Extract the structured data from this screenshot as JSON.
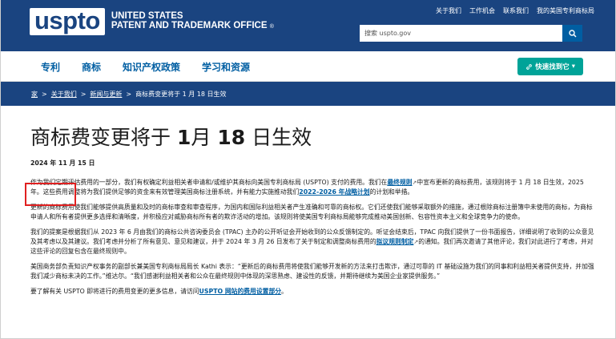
{
  "header": {
    "logo_word": "uspto",
    "logo_line1": "UNITED STATES",
    "logo_line2": "PATENT AND TRADEMARK OFFICE",
    "logo_reg": "®",
    "util_links": [
      "关于我们",
      "工作机会",
      "联系我们",
      "我的美国专利商标局"
    ],
    "search_placeholder": "搜索 uspto.gov"
  },
  "nav": {
    "items": [
      "专利",
      "商标",
      "知识产权政策",
      "学习和资源"
    ],
    "quick_button": "快速找到它"
  },
  "breadcrumb": {
    "home": "家",
    "about": "关于我们",
    "news": "新闻与更新",
    "current": "商标费变更将于 1 月 18 日生效"
  },
  "article": {
    "title_a": "商标费变更将于",
    "title_b": "1",
    "title_c": "月",
    "title_d": "18",
    "title_e": "日生效",
    "date": "2024 年 11 月 15 日",
    "p1_a": "作为我们定期评估费用的一部分，我们有权确定利益相关者申请和/或维护其商标向美国专利商标局 (USPTO) 支付的费用。我们在",
    "p1_link1": "最终规则",
    "p1_b": "中宣布更新的商标费用，该规则将于 1 月 18 日生效，2025 年。这些费用调整将为我们提供足够的资金来有效管理美国商标注册系统，并有能力实施推动我们",
    "p1_link2": "2022-2026 年战略计划",
    "p1_c": "的计划和举措。",
    "p2": "更新的商标费用使我们能够提供高质量和及时的商标审查和审查程序，为国内和国际利益相关者产生准确和可靠的商标权。它们还使我们能够采取额外的措施，通过根除商标注册簿中未使用的商标，为商标申请人和所有者提供更多选择和清晰度，并积极应对威胁商标所有者的欺诈活动的增加。该规则将使美国专利商标局能够完成推动美国创新、包容性资本主义和全球竞争力的使命。",
    "p3_a": "我们的提案是根据我们从 2023 年 6 月由我们的商标公共咨询委员会 (TPAC) 主办的公开听证会开始收到的公众反馈制定的。听证会结束后，TPAC 向我们提供了一份书面报告，详细说明了收到的公众意见及其考虑以及其建议。我们考虑并分析了所有意见、意见和建议，并于 2024 年 3 月 26 日发布了关于制定和调整商标费用的",
    "p3_link": "拟议规则制定",
    "p3_b": "的通知。我们再次邀请了其他评论，我们对此进行了考虑，并对这些评论的回复包含在最终规则中。",
    "p4": "美国商务部负责知识产权事务的副部长兼美国专利商标局局长 Kathi 表示：“更新后的商标费用将使我们能够开发新的方法来打击欺诈，通过可靠的 IT 基础设施为我们的同事和利益相关者提供支持，并加强我们减少商标未决的工作。”维达尔。“我们感谢利益相关者和公众在最终规则中体现的深思熟虑、建设性的反馈，并期待继续为美国企业家提供服务。”",
    "p5_a": "要了解有关 USPTO 即将进行的费用变更的更多信息，请访问",
    "p5_link": "USPTO 网站的费用设置部分",
    "p5_b": "。"
  }
}
